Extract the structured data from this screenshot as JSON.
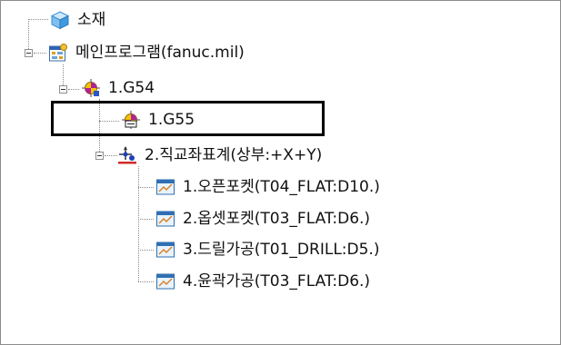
{
  "tree": {
    "material": {
      "label": "소재",
      "icon": "cube-icon"
    },
    "main_program": {
      "label": "메인프로그램(fanuc.mil)",
      "icon": "program-icon"
    },
    "g54": {
      "label": "1.G54",
      "icon": "work-offset-icon"
    },
    "g55": {
      "label": "1.G55",
      "icon": "work-offset-selected-icon"
    },
    "coord": {
      "label": "2.직교좌표계(상부:+X+Y)",
      "icon": "coordinate-axes-icon"
    },
    "ops": [
      {
        "label": "1.오픈포켓(T04_FLAT:D10.)",
        "icon": "toolpath-icon"
      },
      {
        "label": "2.옵셋포켓(T03_FLAT:D6.)",
        "icon": "toolpath-icon"
      },
      {
        "label": "3.드릴가공(T01_DRILL:D5.)",
        "icon": "toolpath-icon"
      },
      {
        "label": "4.윤곽가공(T03_FLAT:D6.)",
        "icon": "toolpath-icon"
      }
    ]
  },
  "colors": {
    "selection_border": "#000000",
    "tree_lines": "#8a8a8a"
  }
}
